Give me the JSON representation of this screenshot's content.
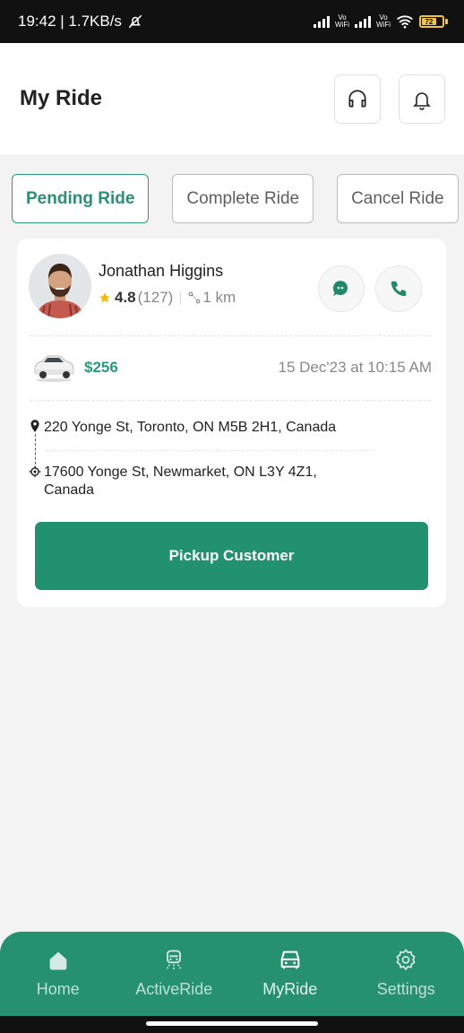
{
  "status_bar": {
    "time_speed": "19:42 | 1.7KB/s",
    "vo_wifi_label_top": "Vo",
    "vo_wifi_label_bottom": "WiFi",
    "battery_level": "72"
  },
  "header": {
    "title": "My Ride",
    "support_icon": "headset-icon",
    "notification_icon": "bell-icon"
  },
  "tabs": [
    {
      "label": "Pending Ride",
      "active": true
    },
    {
      "label": "Complete Ride",
      "active": false
    },
    {
      "label": "Cancel Ride",
      "active": false
    }
  ],
  "ride": {
    "customer_name": "Jonathan Higgins",
    "rating": "4.8",
    "rating_count": "(127)",
    "distance": "1 km",
    "fare": "$256",
    "datetime": "15 Dec'23 at 10:15 AM",
    "pickup_address": "220 Yonge St, Toronto, ON M5B 2H1, Canada",
    "dropoff_address": "17600 Yonge St, Newmarket, ON L3Y 4Z1, Canada",
    "action_label": "Pickup Customer"
  },
  "nav": [
    {
      "label": "Home",
      "icon": "home-icon"
    },
    {
      "label": "ActiveRide",
      "icon": "active-ride-icon"
    },
    {
      "label": "MyRide",
      "icon": "car-icon"
    },
    {
      "label": "Settings",
      "icon": "gear-icon"
    }
  ],
  "colors": {
    "accent": "#22916f",
    "nav_bg": "#26916f",
    "star": "#f5b800"
  }
}
